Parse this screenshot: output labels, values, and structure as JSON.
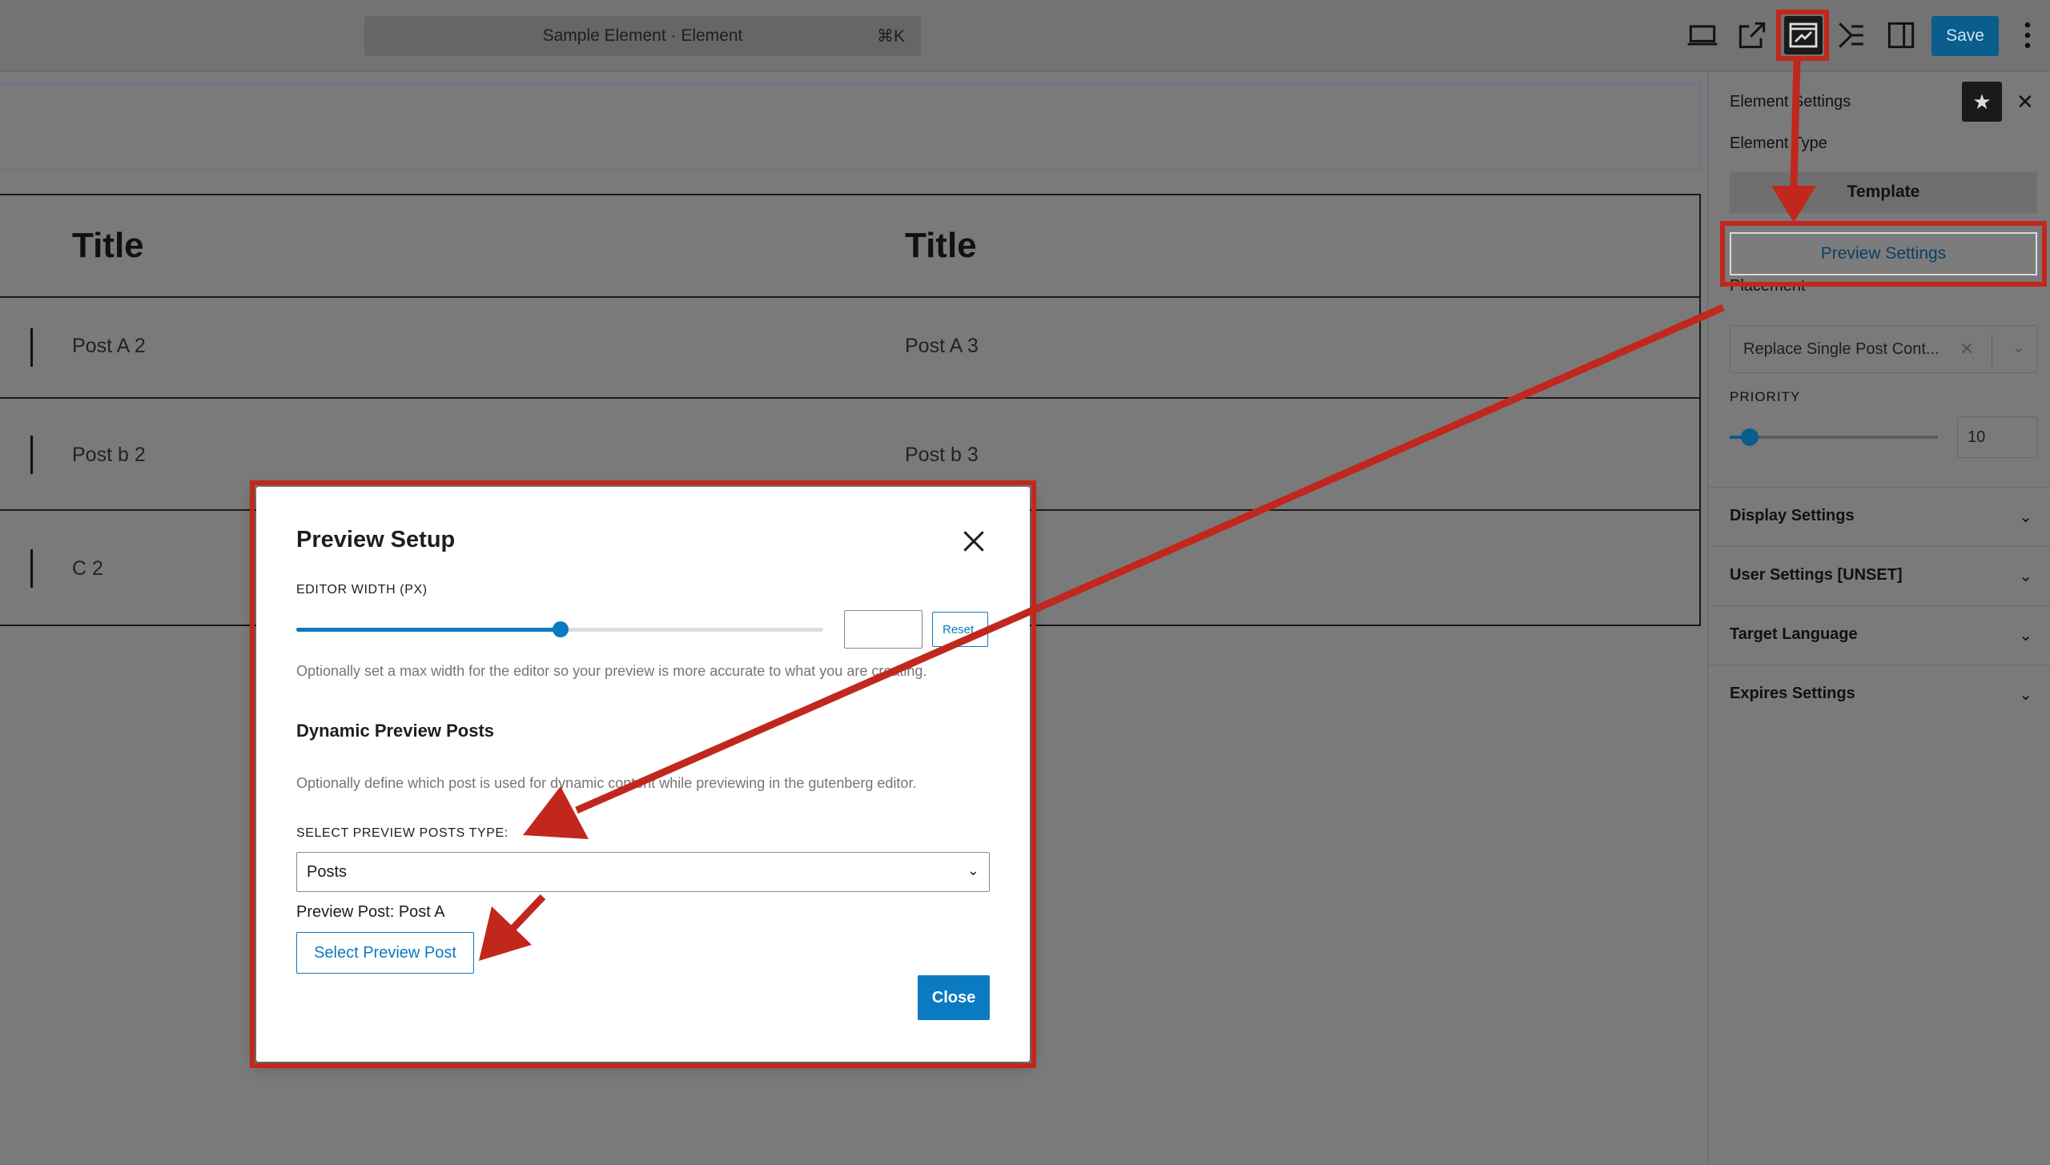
{
  "topbar": {
    "command_title": "Sample Element · Element",
    "command_shortcut": "⌘K",
    "icons": [
      "desktop-preview-icon",
      "external-link-icon",
      "preview-setup-icon",
      "layout-icon",
      "sidebar-toggle-icon"
    ],
    "save_label": "Save",
    "accent": "#0a5d8c"
  },
  "canvas": {
    "headers": [
      "Title",
      "Title"
    ],
    "rows": [
      [
        "Post A 2",
        "Post A 3"
      ],
      [
        "Post b 2",
        "Post b 3"
      ],
      [
        "C 2",
        ""
      ]
    ]
  },
  "sidebar": {
    "title": "Element Settings",
    "element_type_label": "Element Type",
    "template_label": "Template",
    "preview_settings_label": "Preview Settings",
    "placement_label": "Placement",
    "placement_value": "Replace Single Post Cont...",
    "priority_label": "PRIORITY",
    "priority_value": "10",
    "accordions": [
      "Display Settings",
      "User Settings [UNSET]",
      "Target Language",
      "Expires Settings"
    ]
  },
  "modal": {
    "title": "Preview Setup",
    "width_label": "EDITOR WIDTH (PX)",
    "width_value": "",
    "width_slider_fraction": 0.5,
    "reset_label": "Reset",
    "width_help": "Optionally set a max width for the editor so your preview is more accurate to what you are creating.",
    "dynamic_title": "Dynamic Preview Posts",
    "dynamic_help": "Optionally define which post is used for dynamic content while previewing in the gutenberg editor.",
    "type_label": "SELECT PREVIEW POSTS TYPE:",
    "type_value": "Posts",
    "preview_post_text": "Preview Post: Post A",
    "select_post_label": "Select Preview Post",
    "close_label": "Close",
    "accent": "#0a7bc1"
  },
  "annotation_color": "#c1271d"
}
